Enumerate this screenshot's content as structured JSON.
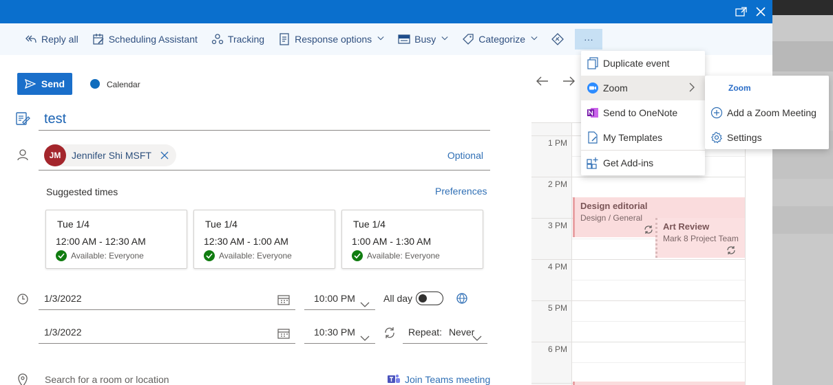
{
  "ribbon": {
    "reply_all": "Reply all",
    "scheduling_assistant": "Scheduling Assistant",
    "tracking": "Tracking",
    "response_options": "Response options",
    "busy": "Busy",
    "categorize": "Categorize",
    "more": "···"
  },
  "compose": {
    "send_label": "Send",
    "calendar_label": "Calendar",
    "title": "test",
    "attendee": {
      "initials": "JM",
      "name": "Jennifer Shi MSFT"
    },
    "optional_label": "Optional",
    "suggested_label": "Suggested times",
    "preferences_label": "Preferences",
    "suggestions": [
      {
        "date": "Tue 1/4",
        "time": "12:00 AM - 12:30 AM",
        "availability": "Available: Everyone"
      },
      {
        "date": "Tue 1/4",
        "time": "12:30 AM - 1:00 AM",
        "availability": "Available: Everyone"
      },
      {
        "date": "Tue 1/4",
        "time": "1:00 AM - 1:30 AM",
        "availability": "Available: Everyone"
      }
    ],
    "start_date": "1/3/2022",
    "start_time": "10:00 PM",
    "end_date": "1/3/2022",
    "end_time": "10:30 PM",
    "all_day_label": "All day",
    "repeat_label": "Repeat:",
    "repeat_value": "Never",
    "location_placeholder": "Search for a room or location",
    "teams_label": "Join Teams meeting"
  },
  "calendar": {
    "hours": [
      "1 PM",
      "2 PM",
      "3 PM",
      "4 PM",
      "5 PM",
      "6 PM"
    ],
    "events": [
      {
        "title": "Design editorial",
        "subtitle": "Design / General"
      },
      {
        "title": "Art Review",
        "subtitle": "Mark 8 Project Team"
      }
    ]
  },
  "more_menu": {
    "items": [
      "Duplicate event",
      "Zoom",
      "Send to OneNote",
      "My Templates",
      "Get Add-ins"
    ]
  },
  "zoom_submenu": {
    "header": "Zoom",
    "items": [
      "Add a Zoom Meeting",
      "Settings"
    ]
  },
  "colors": {
    "title_bar": "#0a6fcd",
    "accent": "#1a6fca",
    "avatar": "#a4262c",
    "event_fill": "#fadcdd",
    "available": "#107c10"
  }
}
